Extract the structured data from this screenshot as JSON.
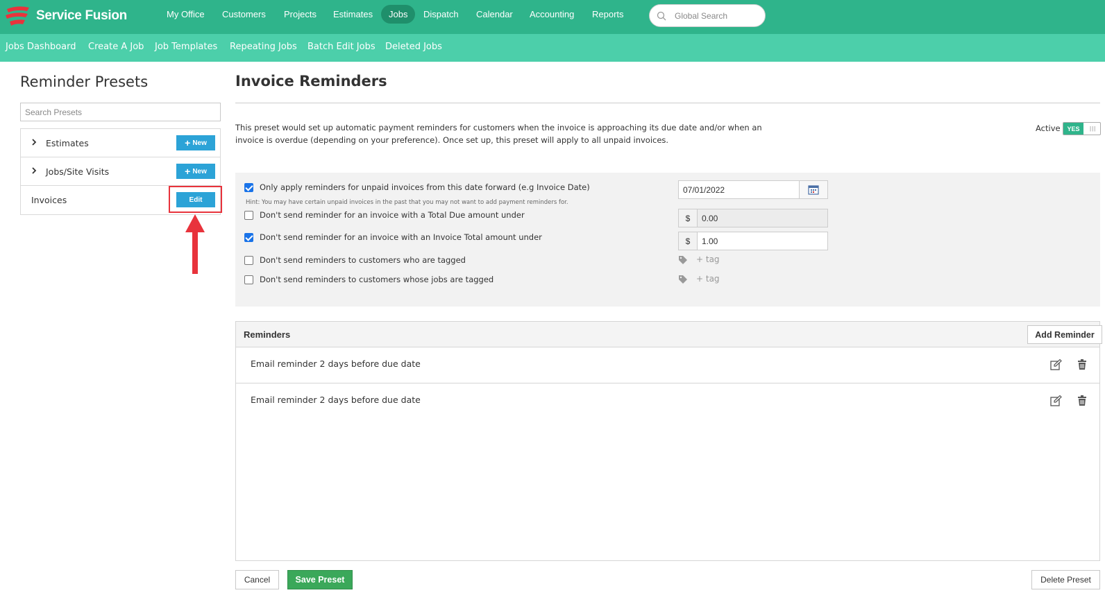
{
  "app": {
    "logo_text": "Service Fusion",
    "brand_color": "#2fb48b",
    "accent_color": "#4ccfaa"
  },
  "top_nav": {
    "items": [
      "My Office",
      "Customers",
      "Projects",
      "Estimates",
      "Jobs",
      "Dispatch",
      "Calendar",
      "Accounting",
      "Reports"
    ],
    "active": "Jobs",
    "search_placeholder": "Global Search"
  },
  "sub_nav": {
    "items": [
      "Jobs Dashboard",
      "Create A Job",
      "Job Templates",
      "Repeating Jobs",
      "Batch Edit Jobs",
      "Deleted Jobs"
    ]
  },
  "left": {
    "title": "Reminder Presets",
    "search_placeholder": "Search Presets",
    "presets": [
      {
        "label": "Estimates",
        "button": "New",
        "expandable": true
      },
      {
        "label": "Jobs/Site Visits",
        "button": "New",
        "expandable": true
      },
      {
        "label": "Invoices",
        "button": "Edit",
        "expandable": false
      }
    ]
  },
  "main": {
    "title": "Invoice Reminders",
    "description": "This preset would set up automatic payment reminders for customers when the invoice is approaching its due date and/or when an invoice is overdue (depending on your preference). Once set up, this preset will apply to all unpaid invoices.",
    "active_label": "Active",
    "active_toggle": "YES",
    "options": [
      {
        "label": "Only apply reminders for unpaid invoices from this date forward (e.g Invoice Date)",
        "checked": true
      },
      {
        "label": "Don't send reminder for an invoice with a Total Due amount under",
        "checked": false
      },
      {
        "label": "Don't send reminder for an invoice with an Invoice Total amount under",
        "checked": true
      },
      {
        "label": "Don't send reminders to customers who are tagged",
        "checked": false
      },
      {
        "label": "Don't send reminders to customers whose jobs are tagged",
        "checked": false
      }
    ],
    "hint": "Hint: You may have certain unpaid invoices in the past that you may not want to add payment reminders for.",
    "date_value": "07/01/2022",
    "currency": "$",
    "total_due_value": "0.00",
    "invoice_total_value": "1.00",
    "tag_placeholder": "+ tag",
    "reminders": {
      "title": "Reminders",
      "add_button": "Add Reminder",
      "items": [
        "Email reminder 2 days before due date",
        "Email reminder 2 days before due date"
      ]
    },
    "buttons": {
      "cancel": "Cancel",
      "save": "Save Preset",
      "delete": "Delete Preset"
    }
  }
}
